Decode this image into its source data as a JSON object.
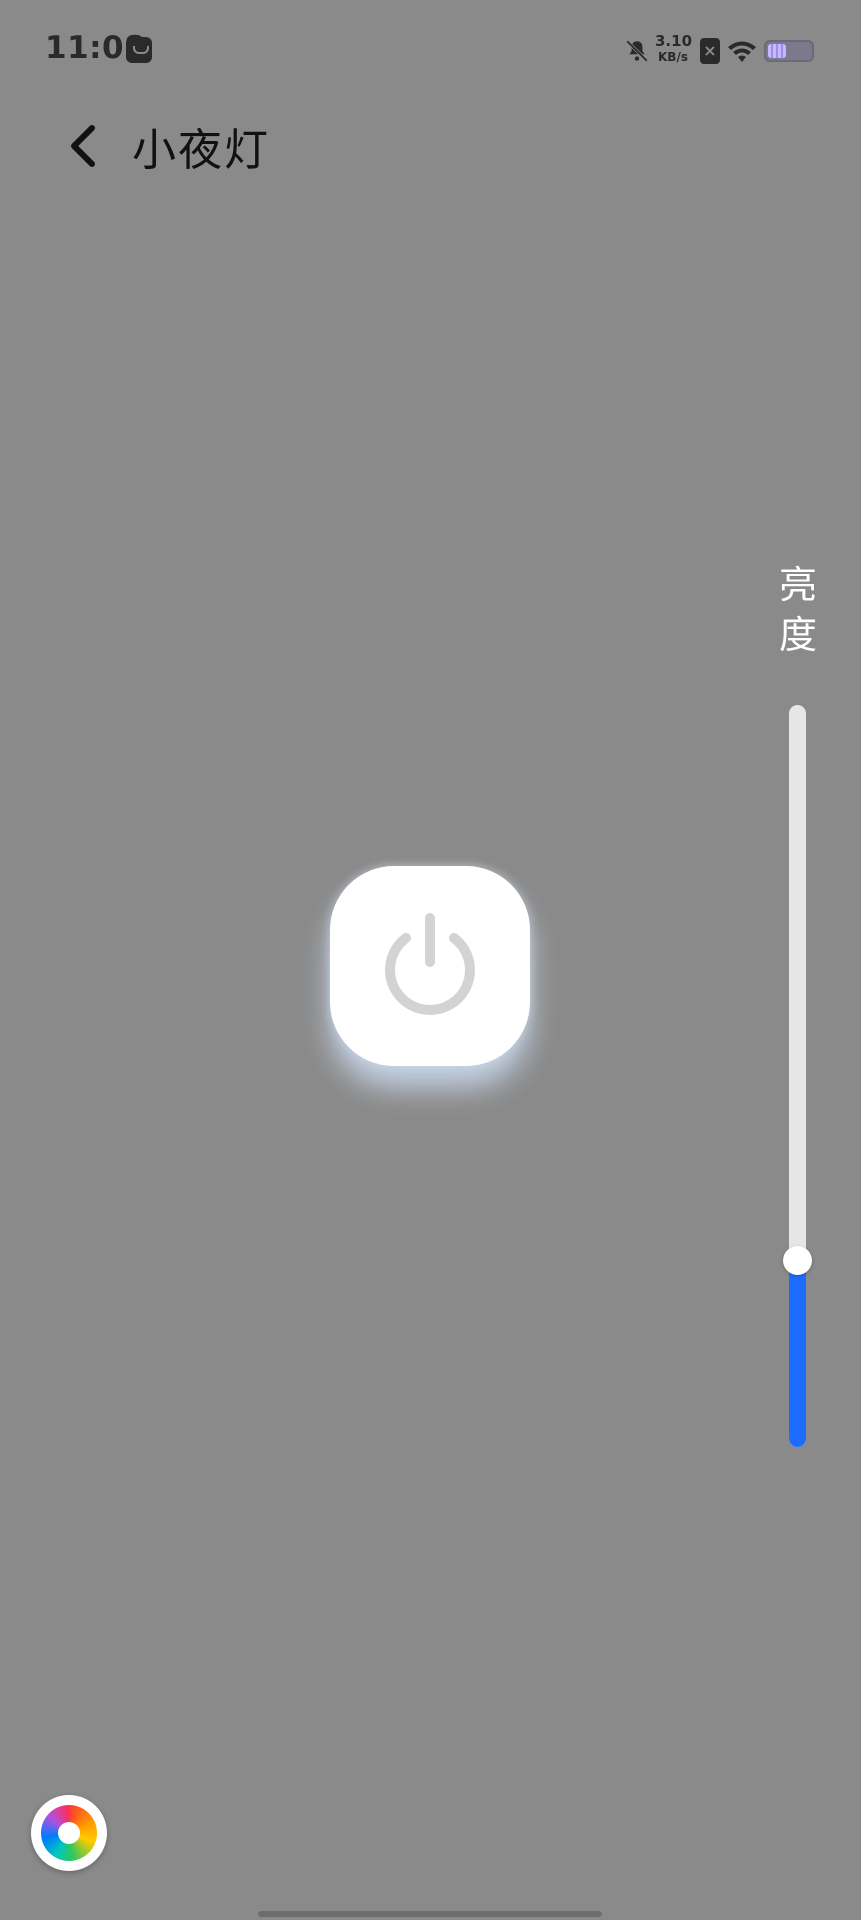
{
  "status_bar": {
    "time": "11:08",
    "net_speed_value": "3.10",
    "net_speed_unit": "KB/s",
    "sim_label": "×",
    "icons": [
      "notification-app-icon",
      "bell-off-icon",
      "sim-x-icon",
      "wifi-icon",
      "battery-icon"
    ]
  },
  "header": {
    "back_icon": "chevron-left-icon",
    "title": "小夜灯"
  },
  "power": {
    "icon": "power-icon"
  },
  "brightness": {
    "label_line1": "亮",
    "label_line2": "度",
    "level_fraction": 0.25,
    "fill_color": "#1d6bff",
    "track_color": "#e6e6e6"
  },
  "color_picker": {
    "icon": "color-wheel-icon"
  },
  "colors": {
    "background": "#8a8a8a",
    "accent": "#1d6bff"
  }
}
